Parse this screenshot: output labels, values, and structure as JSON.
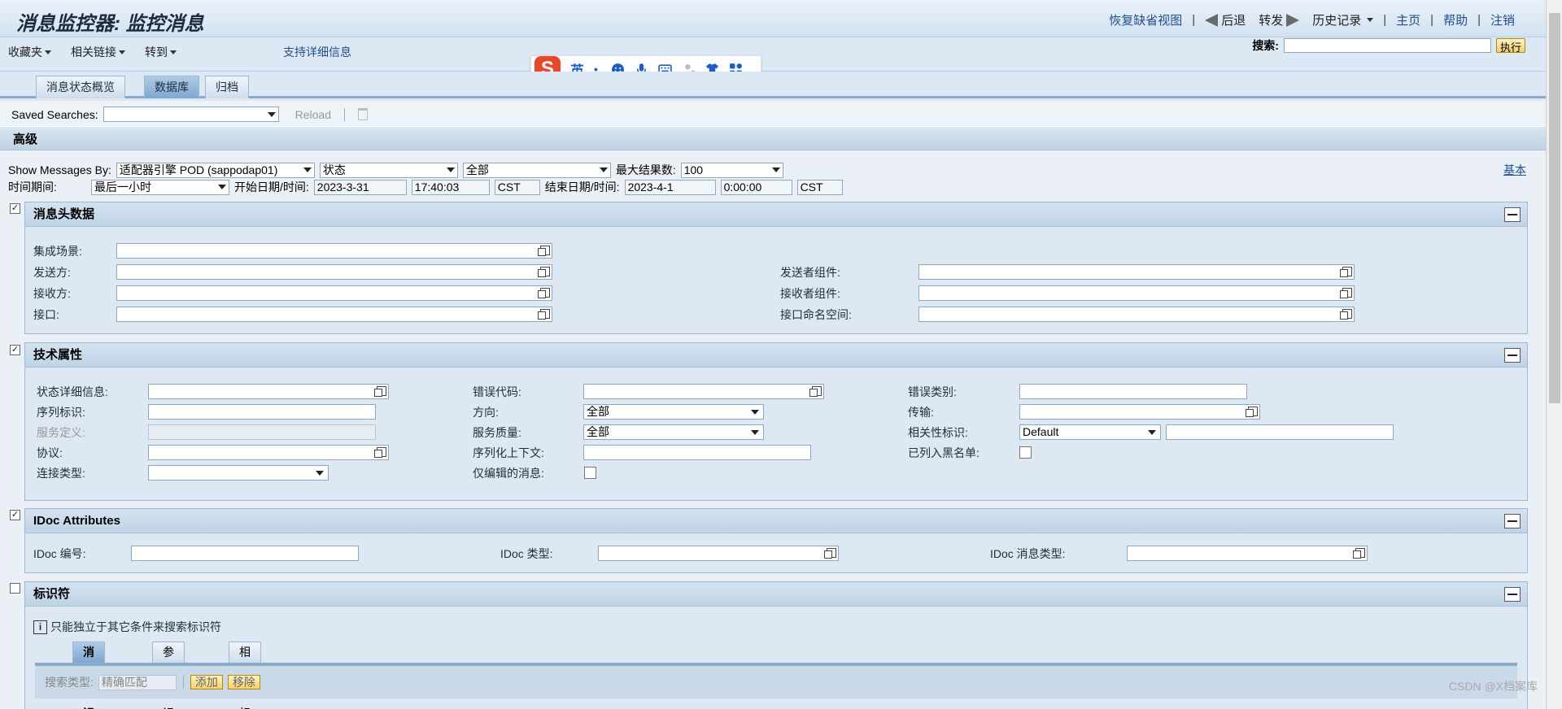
{
  "header": {
    "title": "消息监控器: 监控消息",
    "links": {
      "restore": "恢复缺省视图",
      "back": "后退",
      "forward": "转发",
      "history": "历史记录",
      "home": "主页",
      "help": "帮助",
      "logout": "注销"
    }
  },
  "menubar": {
    "items": [
      "收藏夹",
      "相关链接",
      "转到"
    ],
    "support_link": "支持详细信息",
    "search_label": "搜索:",
    "execute": "执行"
  },
  "ime": {
    "logo": "S",
    "lang": "英",
    "punct": "•,"
  },
  "tabs": [
    "消息状态概览",
    "数据库",
    "归档"
  ],
  "saved_searches": {
    "label": "Saved Searches:",
    "value": "",
    "reload": "Reload"
  },
  "advanced": {
    "title": "高级",
    "basic_link": "基本",
    "show_by_label": "Show Messages By:",
    "show_by_value": "适配器引擎 POD (sappodap01)",
    "status_value": "状态",
    "all_value": "全部",
    "max_results_label": "最大结果数:",
    "max_results_value": "100",
    "period_label": "时间期间:",
    "period_value": "最后一小时",
    "start_label": "开始日期/时间:",
    "start_date": "2023-3-31",
    "start_time": "17:40:03",
    "start_tz": "CST",
    "end_label": "结束日期/时间:",
    "end_date": "2023-4-1",
    "end_time": "0:00:00",
    "end_tz": "CST"
  },
  "sections": {
    "header_data": {
      "title": "消息头数据",
      "checked": true,
      "scenario": "集成场景:",
      "sender": "发送方:",
      "receiver": "接收方:",
      "interface": "接口:",
      "sender_comp": "发送者组件:",
      "receiver_comp": "接收者组件:",
      "interface_ns": "接口命名空间:"
    },
    "tech": {
      "title": "技术属性",
      "checked": true,
      "status_detail": "状态详细信息:",
      "seq_id": "序列标识:",
      "service_def": "服务定义:",
      "protocol": "协议:",
      "conn_type": "连接类型:",
      "error_code": "错误代码:",
      "direction": "方向:",
      "direction_value": "全部",
      "qos": "服务质量:",
      "qos_value": "全部",
      "seq_context": "序列化上下文:",
      "edited_only": "仅编辑的消息:",
      "error_cat": "错误类别:",
      "transport": "传输:",
      "corr_id": "相关性标识:",
      "corr_value": "Default",
      "blacklisted": "已列入黑名单:"
    },
    "idoc": {
      "title": "IDoc Attributes",
      "checked": true,
      "number": "IDoc 编号:",
      "type": "IDoc 类型:",
      "msg_type": "IDoc 消息类型:"
    },
    "ids": {
      "title": "标识符",
      "checked": false,
      "info": "只能独立于其它条件来搜索标识符",
      "subtabs": [
        "消息标识",
        "参考标识",
        "相关性标识"
      ],
      "search_type_label": "搜索类型:",
      "search_type_value": "精确匹配",
      "add": "添加",
      "remove": "移除"
    }
  },
  "watermark": "CSDN @X档案库"
}
